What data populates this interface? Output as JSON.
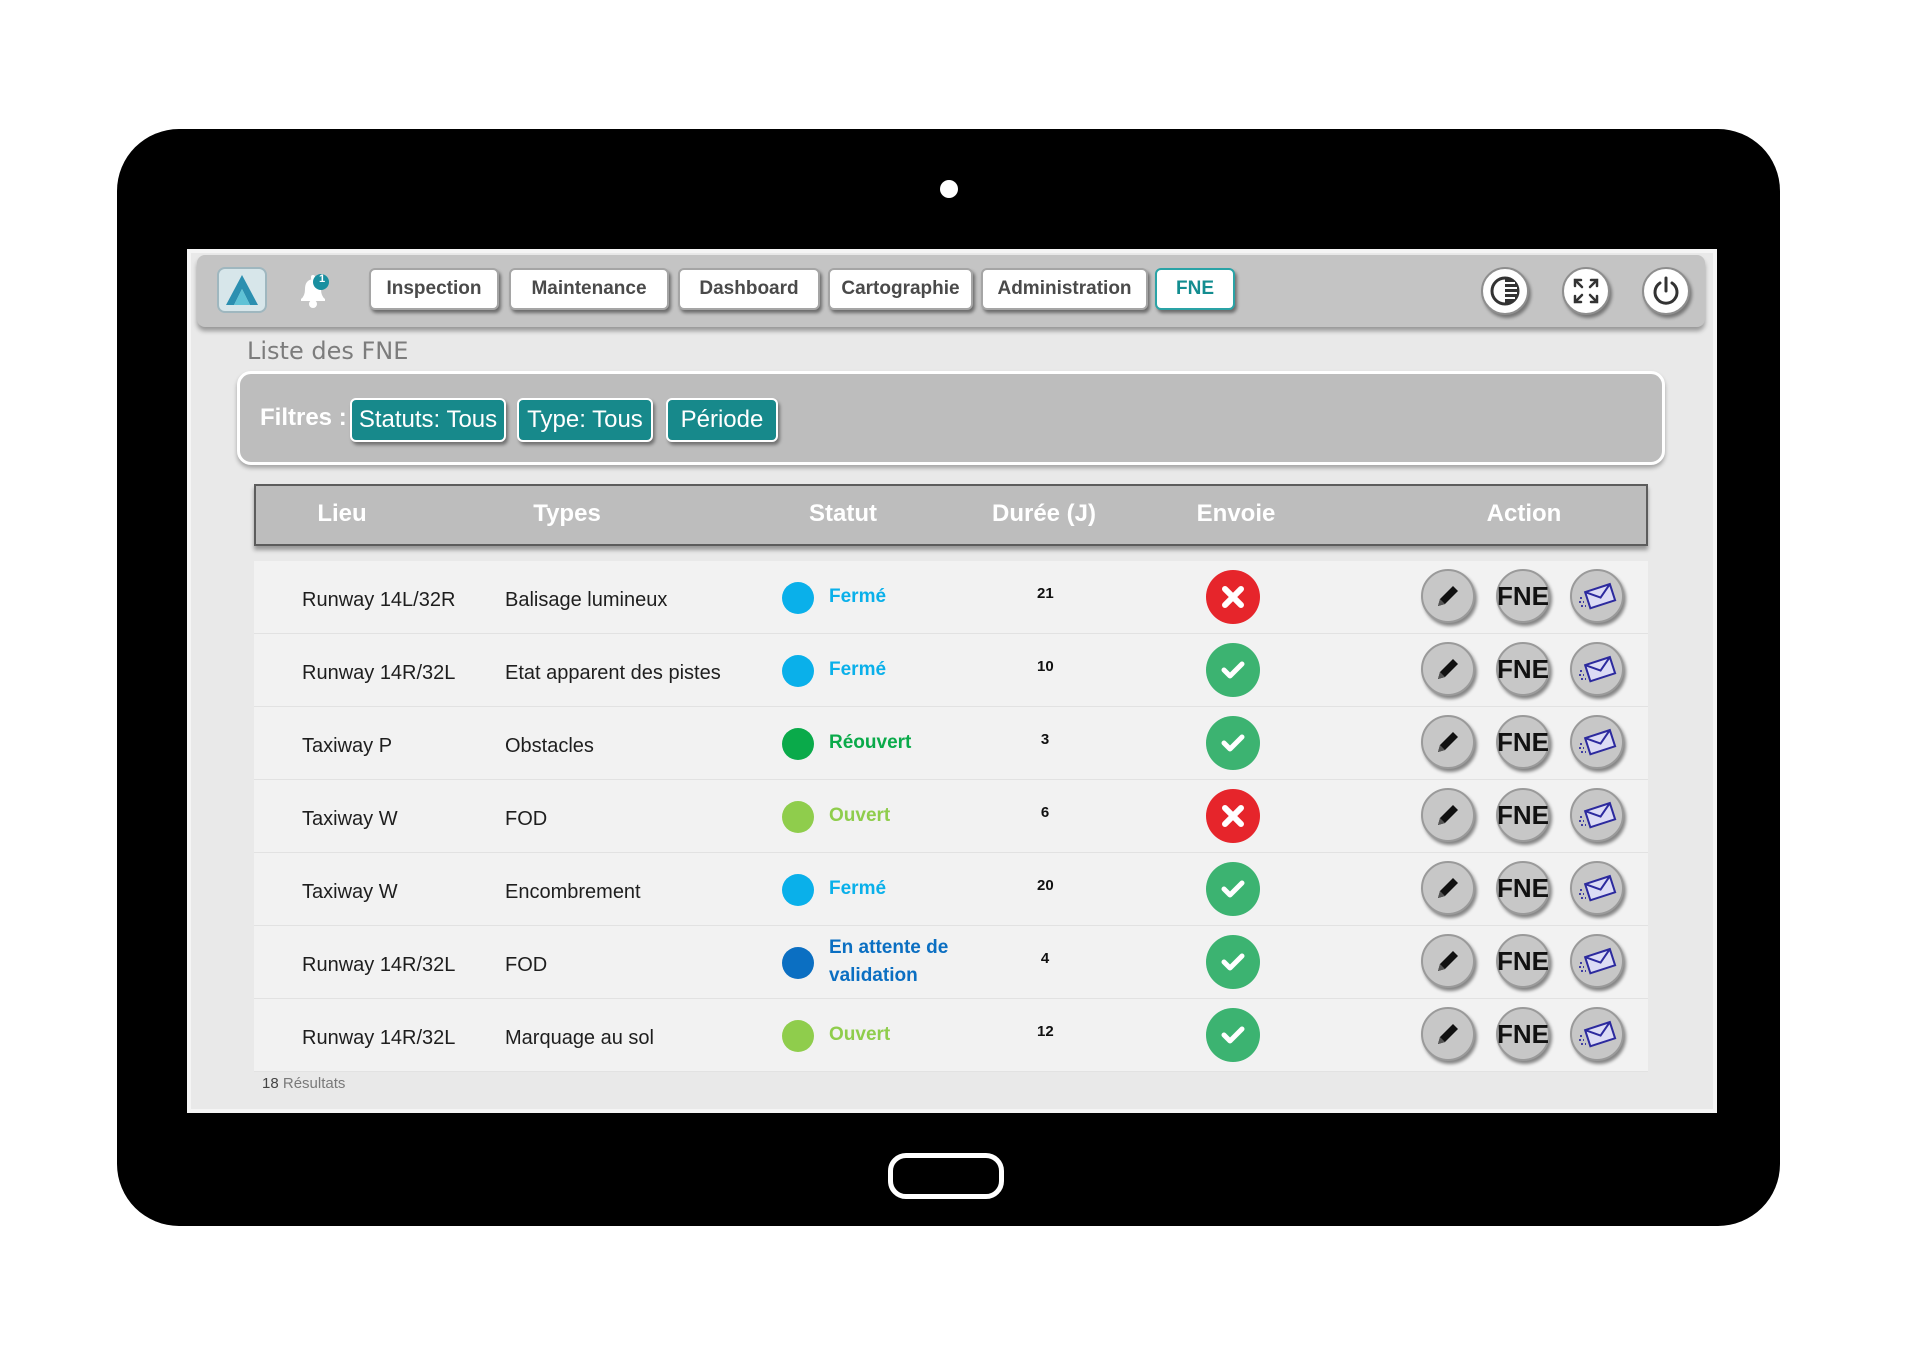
{
  "nav": {
    "notifications_count": "1",
    "tabs": [
      {
        "label": "Inspection",
        "active": false
      },
      {
        "label": "Maintenance",
        "active": false
      },
      {
        "label": "Dashboard",
        "active": false
      },
      {
        "label": "Cartographie",
        "active": false
      },
      {
        "label": "Administration",
        "active": false
      },
      {
        "label": "FNE",
        "active": true
      }
    ],
    "right_icons": [
      "contrast-icon",
      "fullscreen-icon",
      "power-icon"
    ]
  },
  "page": {
    "title": "Liste des FNE"
  },
  "filters": {
    "label": "Filtres :",
    "chips": [
      "Statuts: Tous",
      "Type: Tous",
      "Période"
    ]
  },
  "table": {
    "headers": {
      "lieu": "Lieu",
      "types": "Types",
      "statut": "Statut",
      "duree": "Durée (J)",
      "envoie": "Envoie",
      "action": "Action"
    },
    "fne_label": "FNE",
    "rows": [
      {
        "lieu": "Runway 14L/32R",
        "type": "Balisage lumineux",
        "statut": "Fermé",
        "status_color": "#0ab0ea",
        "duree": "21",
        "envoie": "ko"
      },
      {
        "lieu": "Runway 14R/32L",
        "type": "Etat apparent des pistes",
        "statut": "Fermé",
        "status_color": "#0ab0ea",
        "duree": "10",
        "envoie": "ok"
      },
      {
        "lieu": "Taxiway P",
        "type": "Obstacles",
        "statut": "Réouvert",
        "status_color": "#0aaa4a",
        "duree": "3",
        "envoie": "ok"
      },
      {
        "lieu": "Taxiway W",
        "type": "FOD",
        "statut": "Ouvert",
        "status_color": "#8fcd4c",
        "duree": "6",
        "envoie": "ko"
      },
      {
        "lieu": "Taxiway W",
        "type": "Encombrement",
        "statut": "Fermé",
        "status_color": "#0ab0ea",
        "duree": "20",
        "envoie": "ok"
      },
      {
        "lieu": "Runway 14R/32L",
        "type": "FOD",
        "statut": "En attente de validation",
        "statut_line1": "En attente de",
        "statut_line2": "validation",
        "status_color": "#0b6fc2",
        "duree": "4",
        "envoie": "ok"
      },
      {
        "lieu": "Runway 14R/32L",
        "type": "Marquage au sol",
        "statut": "Ouvert",
        "status_color": "#8fcd4c",
        "duree": "12",
        "envoie": "ok"
      }
    ]
  },
  "footer": {
    "count": "18",
    "label": "Résultats"
  },
  "colors": {
    "accent": "#17898b",
    "ok": "#3cb371",
    "ko": "#e6252b"
  }
}
